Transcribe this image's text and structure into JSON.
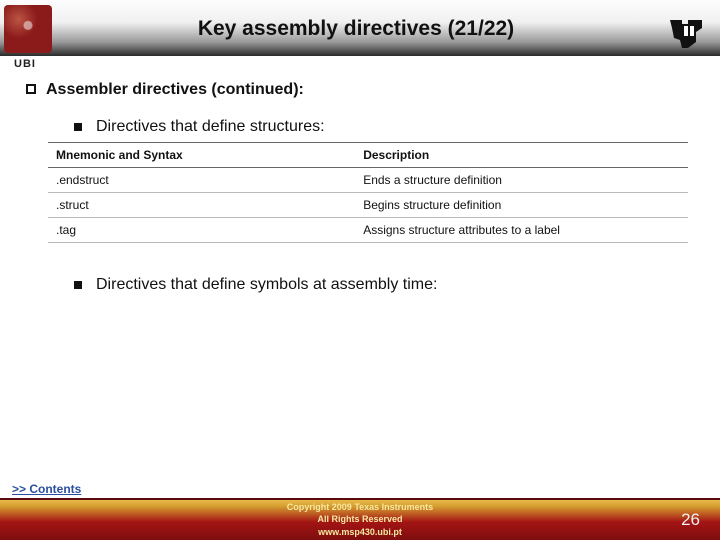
{
  "header": {
    "title": "Key assembly directives (21/22)",
    "ubi_label": "UBI"
  },
  "content": {
    "top_bullet": "Assembler directives (continued):",
    "sub1": "Directives that define structures:",
    "sub2": "Directives that define symbols at assembly time:",
    "table": {
      "col1": "Mnemonic and Syntax",
      "col2": "Description",
      "rows": [
        {
          "mn": ".endstruct",
          "desc": "Ends a structure definition"
        },
        {
          "mn": ".struct",
          "desc": "Begins structure definition"
        },
        {
          "mn": ".tag",
          "desc": "Assigns structure attributes to a label"
        }
      ]
    }
  },
  "footer": {
    "contents_link": ">> Contents",
    "copyright_line1": "Copyright 2009 Texas Instruments",
    "copyright_line2": "All Rights Reserved",
    "url": "www.msp430.ubi.pt",
    "page_number": "26"
  }
}
